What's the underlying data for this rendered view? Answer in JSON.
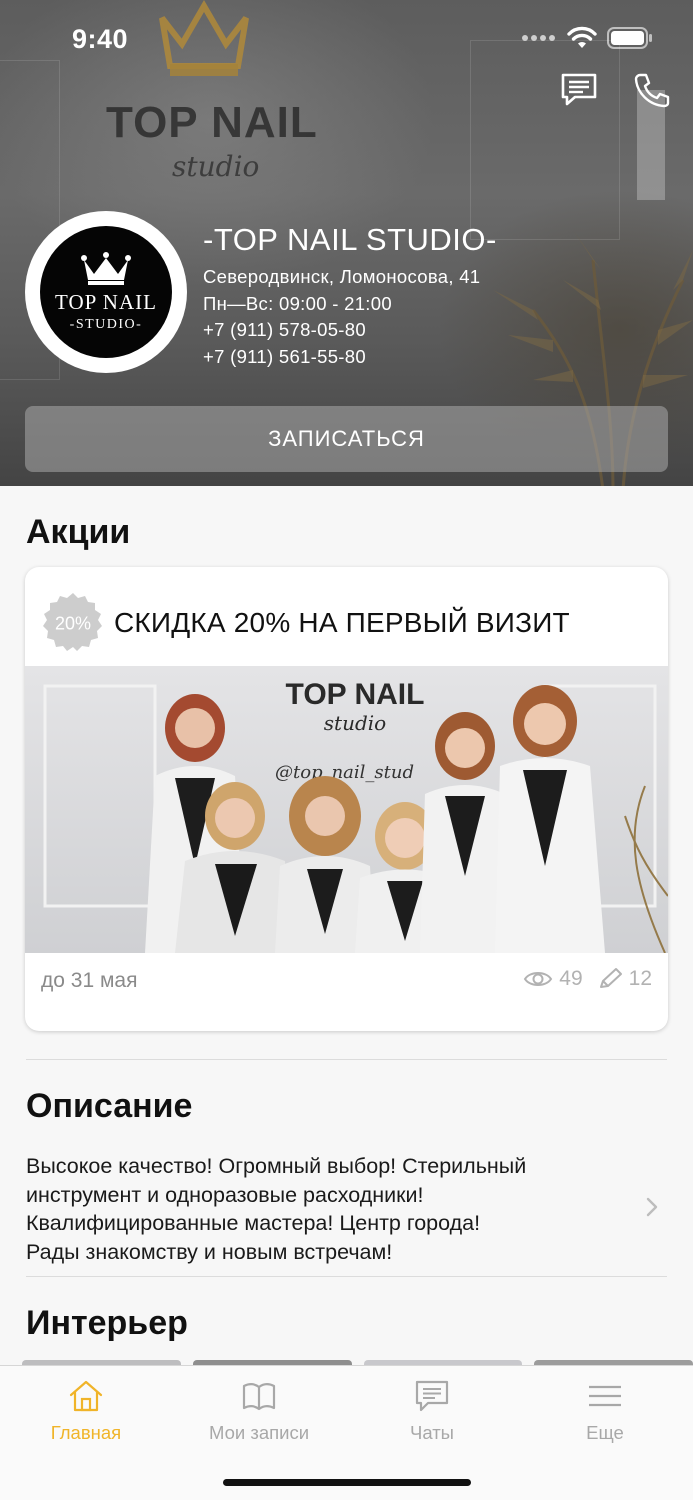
{
  "status": {
    "time": "9:40"
  },
  "salon": {
    "name": "-TOP NAIL STUDIO-",
    "address": "Северодвинск, Ломоносова, 41",
    "hours": "Пн—Вс: 09:00 - 21:00",
    "phone1": "+7 (911) 578-05-80",
    "phone2": "+7 (911) 561-55-80",
    "logo_text_top": "TOP NAIL",
    "logo_text_bottom": "-STUDIO-"
  },
  "hero": {
    "wall_sign_main": "TOP NAIL",
    "wall_sign_sub": "studio",
    "book_button": "ЗАПИСАТЬСЯ"
  },
  "promotions": {
    "title": "Акции",
    "items": [
      {
        "badge": "20%",
        "title": "СКИДКА 20% НА ПЕРВЫЙ ВИЗИТ",
        "photo_sign": "TOP NAIL",
        "photo_sign_sub": "studio",
        "photo_handle": "@top_nail_stud",
        "until": "до 31 мая",
        "views": "49",
        "edits": "12"
      }
    ]
  },
  "description": {
    "title": "Описание",
    "text": "Высокое качество! Огромный выбор! Стерильный\nинструмент и одноразовые расходники!\nКвалифицированные мастера! Центр города!\nРады знакомству и новым встречам!"
  },
  "interior": {
    "title": "Интерьер"
  },
  "tabbar": {
    "items": [
      {
        "label": "Главная",
        "icon": "home-icon",
        "active": true
      },
      {
        "label": "Мои записи",
        "icon": "book-icon",
        "active": false
      },
      {
        "label": "Чаты",
        "icon": "chat-icon",
        "active": false
      },
      {
        "label": "Еще",
        "icon": "menu-icon",
        "active": false
      }
    ]
  },
  "colors": {
    "accent": "#f0b429",
    "inactive": "#a8a8a8",
    "background": "#f7f7f7"
  }
}
